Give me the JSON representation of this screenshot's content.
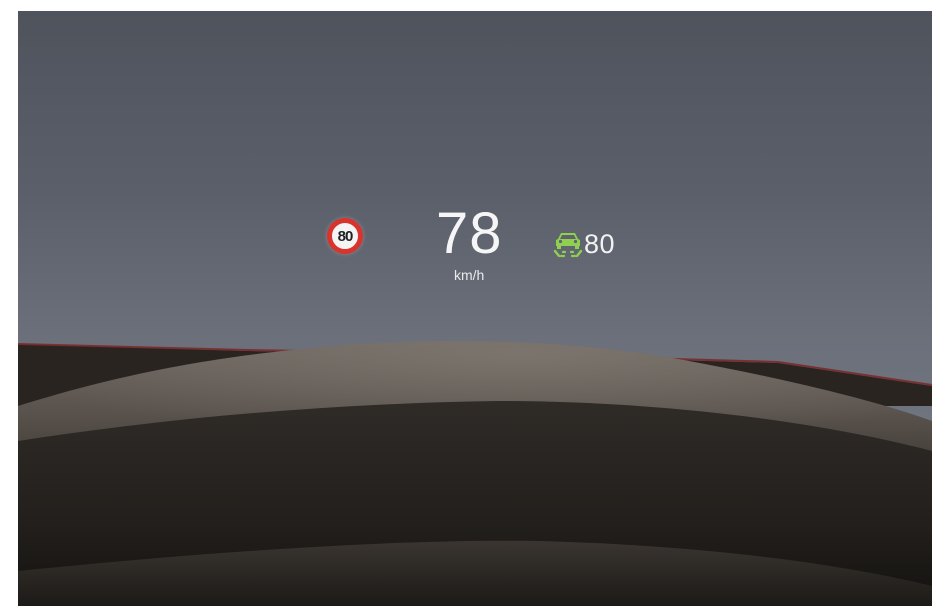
{
  "hud": {
    "speed_limit": "80",
    "speed": "78",
    "speed_unit": "km/h",
    "cruise_set_speed": "80",
    "icons": {
      "speed_limit": "speed-limit-sign-icon",
      "cruise": "adaptive-cruise-control-icon"
    },
    "colors": {
      "speed_limit_ring": "#d8342d",
      "cruise_icon": "#8fd14f",
      "hud_text": "#f6f6f6"
    }
  }
}
